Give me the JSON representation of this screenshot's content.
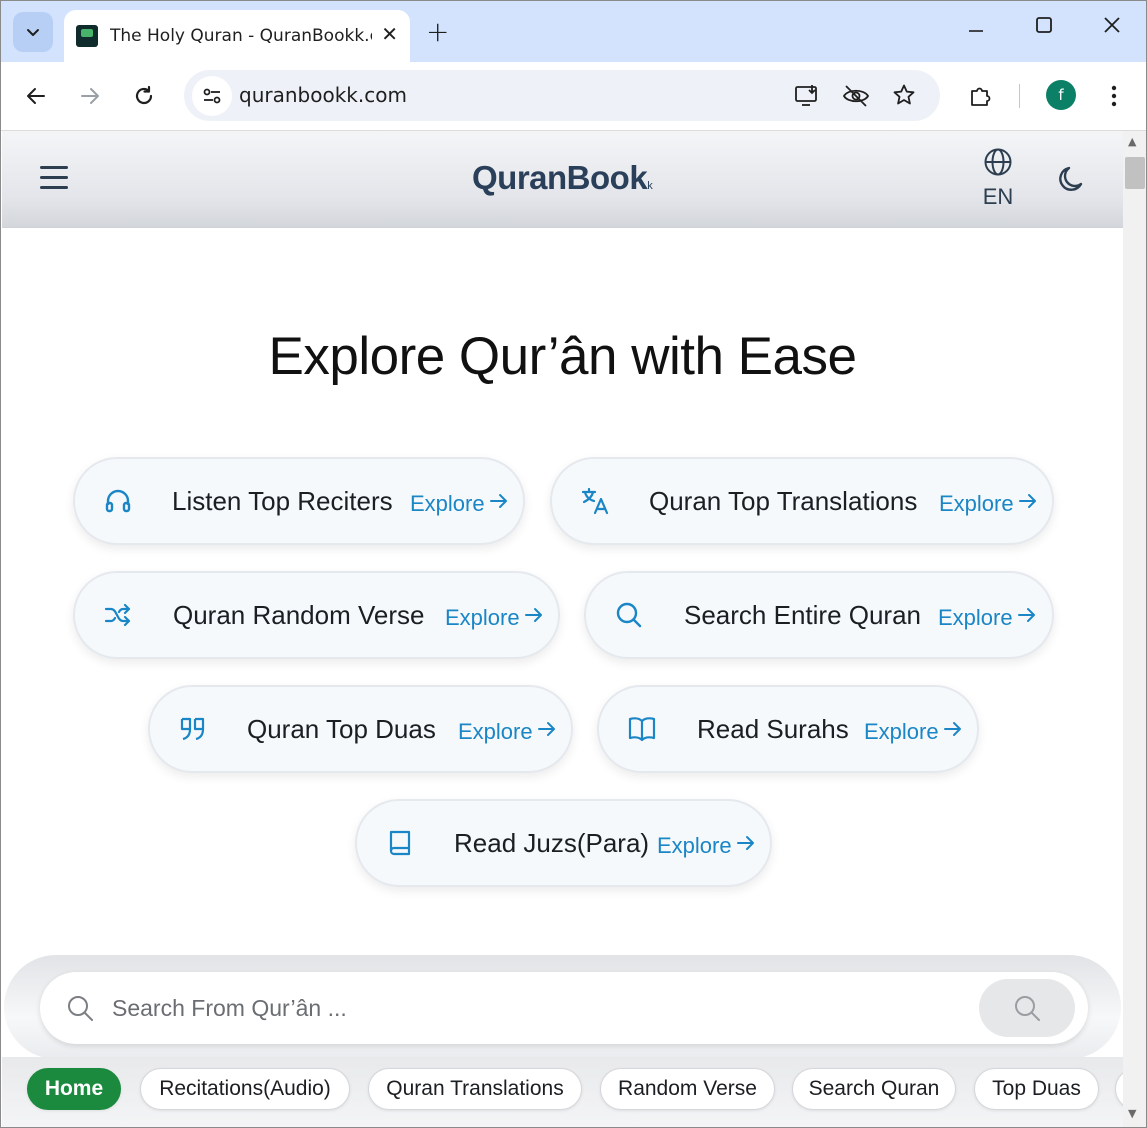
{
  "browser": {
    "tab_title": "The Holy Quran - QuranBookk.com",
    "url": "quranbookk.com",
    "profile_initial": "f"
  },
  "site": {
    "logo": "QuranBook",
    "logo_suffix": "k",
    "language": "EN"
  },
  "hero": {
    "title": "Explore Qur’ân with Ease"
  },
  "cards": [
    {
      "label": "Listen Top Reciters",
      "action": "Explore",
      "icon": "headphones-icon"
    },
    {
      "label": "Quran Top Translations",
      "action": "Explore",
      "icon": "translate-icon"
    },
    {
      "label": "Quran Random Verse",
      "action": "Explore",
      "icon": "shuffle-icon"
    },
    {
      "label": "Search Entire Quran",
      "action": "Explore",
      "icon": "search-icon"
    },
    {
      "label": "Quran Top Duas",
      "action": "Explore",
      "icon": "quote-icon"
    },
    {
      "label": "Read Surahs",
      "action": "Explore",
      "icon": "open-book-icon"
    },
    {
      "label": "Read Juzs(Para)",
      "action": "Explore",
      "icon": "book-icon"
    }
  ],
  "search": {
    "placeholder": "Search From Qur’ân ..."
  },
  "chips": [
    {
      "label": "Home",
      "active": true
    },
    {
      "label": "Recitations(Audio)",
      "active": false
    },
    {
      "label": "Quran Translations",
      "active": false
    },
    {
      "label": "Random Verse",
      "active": false
    },
    {
      "label": "Search Quran",
      "active": false
    },
    {
      "label": "Top Duas",
      "active": false
    }
  ],
  "colors": {
    "accent": "#1b86c6",
    "active_chip": "#1b8a3f",
    "heading": "#2a3f5a"
  }
}
